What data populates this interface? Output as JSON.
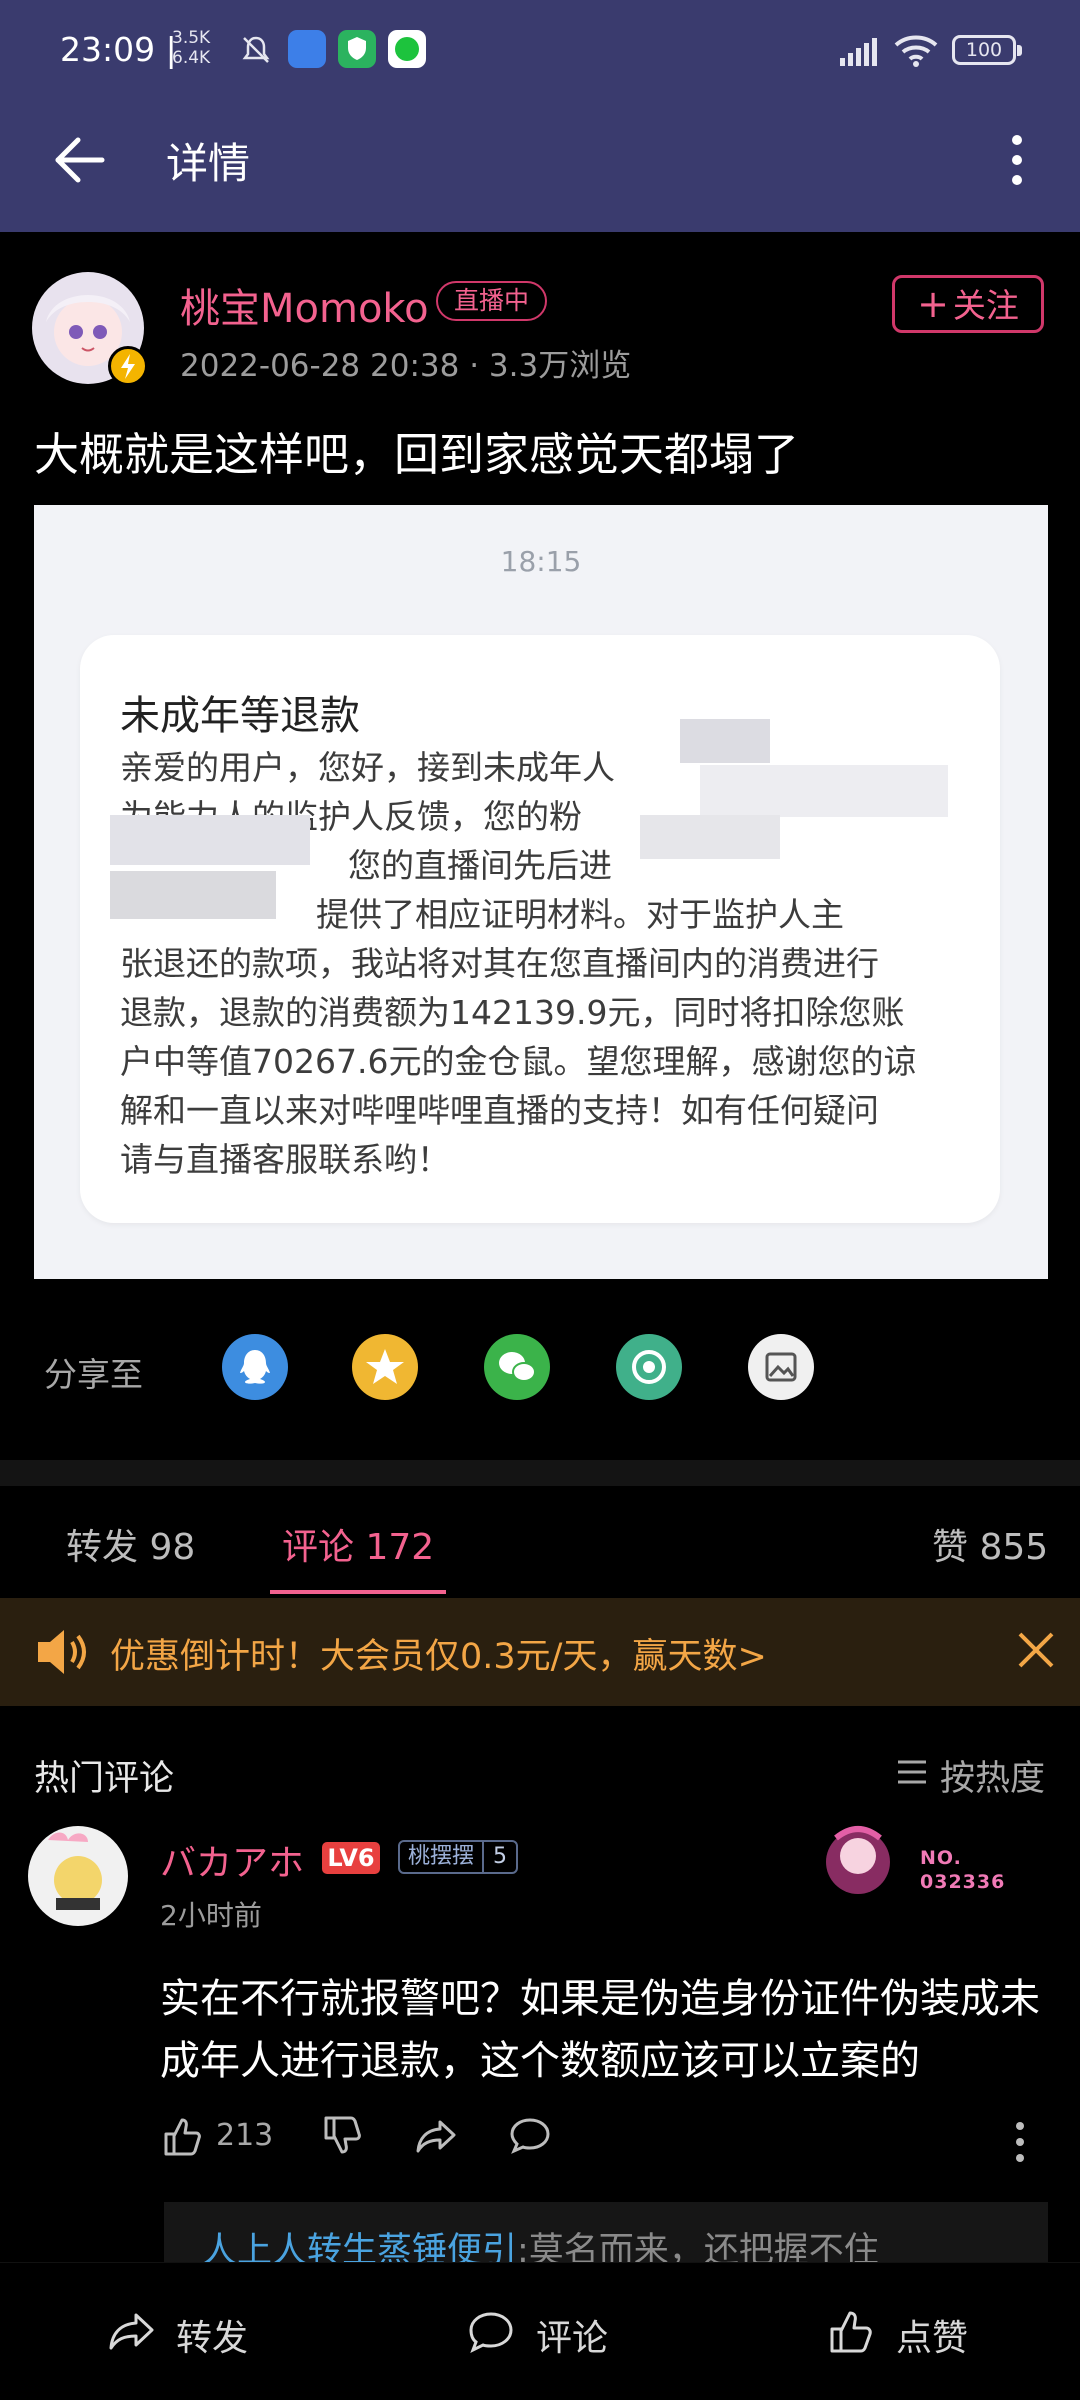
{
  "status_bar": {
    "time": "23:09 |",
    "net_up": "3.5K",
    "net_down": "6.4K",
    "battery": "100"
  },
  "header": {
    "title": "详情"
  },
  "post": {
    "author": "桃宝Momoko",
    "live_badge": "直播中",
    "meta": "2022-06-28 20:38 · 3.3万浏览",
    "follow_label": "关注",
    "text": "大概就是这样吧，回到家感觉天都塌了",
    "screenshot": {
      "time": "18:15",
      "title": "未成年等退款",
      "lines": [
        "亲爱的用户，您好，接到未成年人",
        "为能力人的监护人反馈，您的粉",
        "您的直播间先后进",
        "提供了相应证明材料。对于监护人主",
        "张退还的款项，我站将对其在您直播间内的消费进行",
        "退款，退款的消费额为142139.9元，同时将扣除您账",
        "户中等值70267.6元的金仓鼠。望您理解，感谢您的谅",
        "解和一直以来对哔哩哔哩直播的支持！如有任何疑问",
        "请与直播客服联系哟！"
      ]
    }
  },
  "share": {
    "label": "分享至",
    "targets": [
      {
        "icon": "qq-icon",
        "color": "#3d8de0"
      },
      {
        "icon": "qzone-icon",
        "color": "#f0b732"
      },
      {
        "icon": "wechat-icon",
        "color": "#3bb34a"
      },
      {
        "icon": "moments-icon",
        "color": "#40b08a"
      },
      {
        "icon": "save-image-icon",
        "color": "#f0f0f0"
      }
    ]
  },
  "tabs": {
    "repost": "转发 98",
    "comments": "评论 172",
    "likes": "赞 855"
  },
  "promo": {
    "text": "优惠倒计时！大会员仅0.3元/天，赢天数>"
  },
  "comments": {
    "section_title": "热门评论",
    "sort_label": "按热度",
    "items": [
      {
        "user": "バカアホ",
        "level": "LV6",
        "medal_name": "桃摆摆",
        "medal_level": "5",
        "fan_card_no": "NO.",
        "fan_card_num": "032336",
        "time": "2小时前",
        "text": "实在不行就报警吧？如果是伪造身份证件伪装成未成年人进行退款，这个数额应该可以立案的",
        "likes": "213",
        "reply_user": "人上人转生蒸锤便引",
        "reply_text": ":莫名而来，还把握不住"
      }
    ]
  },
  "bottom_bar": {
    "repost": "转发",
    "comment": "评论",
    "like": "点赞"
  }
}
